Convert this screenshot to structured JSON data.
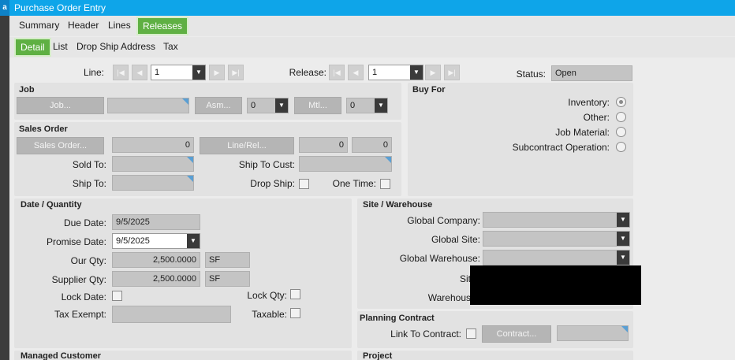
{
  "window": {
    "title": "Purchase Order Entry",
    "side_indicator": "a"
  },
  "tabs": {
    "main": [
      {
        "label": "Summary"
      },
      {
        "label": "Header"
      },
      {
        "label": "Lines"
      },
      {
        "label": "Releases",
        "active": true
      }
    ],
    "sub": [
      {
        "label": "Detail",
        "active": true
      },
      {
        "label": "List"
      },
      {
        "label": "Drop Ship Address"
      },
      {
        "label": "Tax"
      }
    ]
  },
  "top": {
    "line_label": "Line:",
    "line_value": "1",
    "release_label": "Release:",
    "release_value": "1",
    "status_label": "Status:",
    "status_value": "Open"
  },
  "job": {
    "title": "Job",
    "job_button": "Job...",
    "asm_button": "Asm...",
    "asm_value": "0",
    "mtl_button": "Mtl...",
    "mtl_value": "0"
  },
  "buy_for": {
    "title": "Buy For",
    "options": [
      {
        "label": "Inventory:",
        "selected": true
      },
      {
        "label": "Other:",
        "selected": false
      },
      {
        "label": "Job Material:",
        "selected": false
      },
      {
        "label": "Subcontract Operation:",
        "selected": false
      }
    ]
  },
  "sales_order": {
    "title": "Sales Order",
    "sales_order_button": "Sales Order...",
    "sales_order_value": "0",
    "line_rel_button": "Line/Rel...",
    "line_value": "0",
    "rel_value": "0",
    "sold_to_label": "Sold To:",
    "ship_to_cust_label": "Ship To Cust:",
    "ship_to_label": "Ship To:",
    "drop_ship_label": "Drop Ship:",
    "one_time_label": "One Time:"
  },
  "date_qty": {
    "title": "Date / Quantity",
    "due_date_label": "Due Date:",
    "due_date_value": "9/5/2025",
    "promise_date_label": "Promise Date:",
    "promise_date_value": "9/5/2025",
    "our_qty_label": "Our Qty:",
    "our_qty_value": "2,500.0000",
    "our_qty_uom": "SF",
    "supplier_qty_label": "Supplier Qty:",
    "supplier_qty_value": "2,500.0000",
    "supplier_qty_uom": "SF",
    "lock_date_label": "Lock Date:",
    "lock_qty_label": "Lock Qty:",
    "tax_exempt_label": "Tax Exempt:",
    "taxable_label": "Taxable:"
  },
  "site_warehouse": {
    "title": "Site / Warehouse",
    "global_company_label": "Global Company:",
    "global_site_label": "Global Site:",
    "global_warehouse_label": "Global Warehouse:",
    "site_label": "Sit",
    "warehouse_label": "Warehous"
  },
  "planning_contract": {
    "title": "Planning Contract",
    "link_label": "Link To Contract:",
    "contract_button": "Contract..."
  },
  "managed_customer": {
    "title": "Managed Customer"
  },
  "project": {
    "title": "Project"
  }
}
